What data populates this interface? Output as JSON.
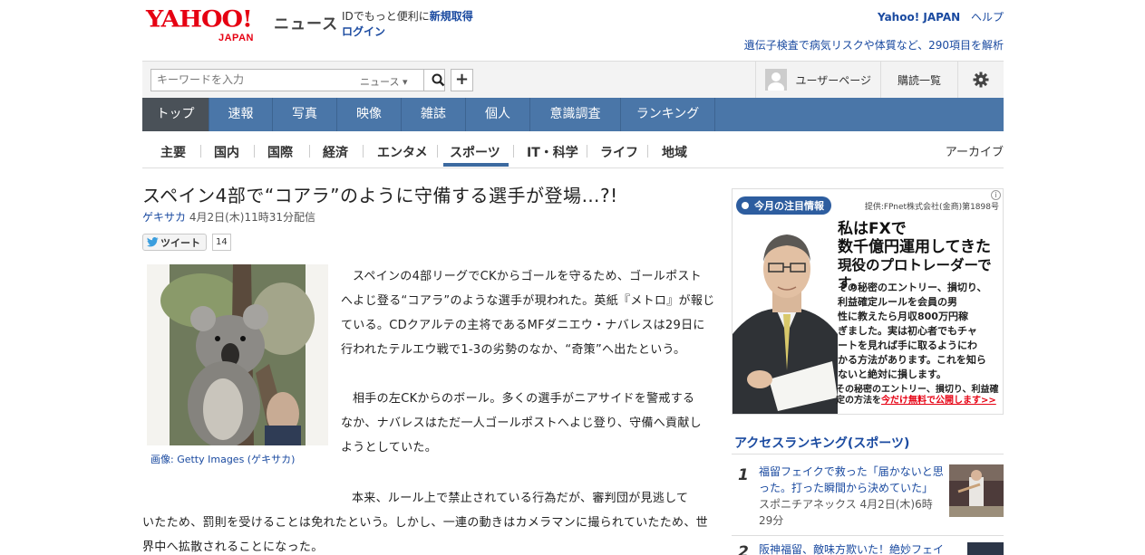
{
  "header": {
    "logo_text": "YAHOO!",
    "logo_sub": "JAPAN",
    "service": "ニュース",
    "promo_plain": "IDでもっと便利に",
    "promo_signup": "新規取得",
    "promo_login": "ログイン",
    "yj_link": "Yahoo! JAPAN",
    "help_link": "ヘルプ",
    "ad_link": "遺伝子検査で病気リスクや体質など、290項目を解析"
  },
  "search": {
    "placeholder": "キーワードを入力",
    "scope": "ニュース"
  },
  "user": {
    "user_page": "ユーザーページ",
    "subscriptions": "購読一覧"
  },
  "main_nav": [
    {
      "label": "トップ"
    },
    {
      "label": "速報"
    },
    {
      "label": "写真"
    },
    {
      "label": "映像"
    },
    {
      "label": "雑誌"
    },
    {
      "label": "個人"
    },
    {
      "label": "意識調査"
    },
    {
      "label": "ランキング"
    }
  ],
  "sub_nav": [
    {
      "label": "主要"
    },
    {
      "label": "国内"
    },
    {
      "label": "国際"
    },
    {
      "label": "経済"
    },
    {
      "label": "エンタメ"
    },
    {
      "label": "スポーツ"
    },
    {
      "label": "IT・科学"
    },
    {
      "label": "ライフ"
    },
    {
      "label": "地域"
    }
  ],
  "sub_nav_active": "スポーツ",
  "archive": "アーカイブ",
  "article": {
    "title": "スペイン4部で“コアラ”のように守備する選手が登場…?!",
    "source": "ゲキサカ",
    "date": "4月2日(木)11時31分配信",
    "tweet_label": "ツイート",
    "tweet_count": "14",
    "photo_caption": "画像: Getty Images (ゲキサカ)",
    "para1_lines": [
      "スペインの4部リーグでCKからゴールを守るため、ゴールポスト",
      "へよじ登る“コアラ”のような選手が現われた。英紙『メトロ』が報じ",
      "ている。CDクアルテの主将であるMFダニエウ・ナバレスは29日に",
      "行われたテルエウ戦で1-3の劣勢のなか、“奇策”へ出たという。"
    ],
    "para2_lines": [
      "相手の左CKからのボール。多くの選手がニアサイドを警戒する",
      "なか、ナバレスはただ一人ゴールポストへよじ登り、守備へ貢献し",
      "ようとしていた。"
    ],
    "para3_first": "本来、ルール上で禁止されている行為だが、審判団が見逃して",
    "para3_rest": [
      "いたため、罰則を受けることは免れたという。しかし、一連の動きはカメラマンに撮られていたため、世",
      "界中へ拡散されることになった。"
    ]
  },
  "ad": {
    "badge": "今月の注目情報",
    "provider": "提供:FPnet株式会社(金商)第1898号",
    "headline_lines": [
      "私はFXで",
      "数千億円運用してきた",
      "現役のプロトレーダーです。"
    ],
    "body_lines": [
      "その秘密のエントリー、損切り、",
      "利益確定ルールを会員の男",
      "性に教えたら月収800万円稼",
      "ぎました。実は初心者でもチャ",
      "ートを見れば手に取るようにわ",
      "かる方法があります。これを知ら",
      "ないと絶対に損します。"
    ],
    "foot_line1": "その秘密のエントリー、損切り、利益確",
    "foot_line2_plain": "定の方法を",
    "foot_line2_link": "今だけ無料で公開します>>",
    "info": "i"
  },
  "ranking": {
    "title": "アクセスランキング(スポーツ)",
    "items": [
      {
        "rank": "1",
        "text": "福留フェイクで救った「届かないと思った。打った瞬間から決めていた」",
        "source": "スポニチアネックス",
        "time": "4月2日(木)6時29分"
      },
      {
        "rank": "2",
        "text": "阪神福留、敵味方欺いた！絶妙フェイク",
        "source": "",
        "time": ""
      }
    ]
  },
  "colors": {
    "brand_red": "#e60012",
    "nav_blue": "#4a76a8",
    "nav_active": "#4a5158",
    "link_blue": "#1a4aa0"
  }
}
